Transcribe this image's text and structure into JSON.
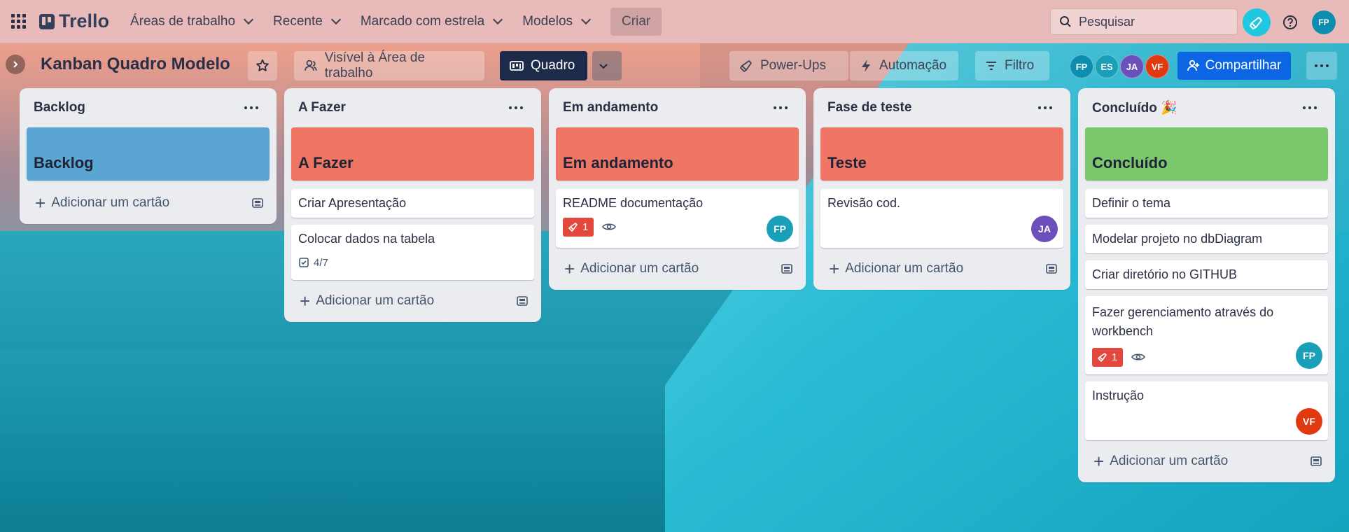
{
  "topbar": {
    "logo": "Trello",
    "nav": [
      {
        "label": "Áreas de trabalho"
      },
      {
        "label": "Recente"
      },
      {
        "label": "Marcado com estrela"
      },
      {
        "label": "Modelos"
      }
    ],
    "create_label": "Criar",
    "search_placeholder": "Pesquisar",
    "user_initials": "FP"
  },
  "board": {
    "title": "Kanban Quadro Modelo",
    "visibility_label": "Visível à Área de trabalho",
    "view_label": "Quadro",
    "powerups_label": "Power-Ups",
    "automation_label": "Automação",
    "filter_label": "Filtro",
    "members": [
      {
        "initials": "FP",
        "color": "#0c8eb0"
      },
      {
        "initials": "ES",
        "color": "#1a9fb8"
      },
      {
        "initials": "JA",
        "color": "#6b4fbb"
      },
      {
        "initials": "VF",
        "color": "#e0380f"
      }
    ],
    "share_label": "Compartilhar"
  },
  "lists": [
    {
      "title": "Backlog",
      "cover": {
        "label": "Backlog",
        "color": "#5aa5d4"
      },
      "cards": [],
      "add_label": "Adicionar um cartão"
    },
    {
      "title": "A Fazer",
      "cover": {
        "label": "A Fazer",
        "color": "#ef7564"
      },
      "cards": [
        {
          "title": "Criar Apresentação"
        },
        {
          "title": "Colocar dados na tabela",
          "checklist": "4/7"
        }
      ],
      "add_label": "Adicionar um cartão"
    },
    {
      "title": "Em andamento",
      "cover": {
        "label": "Em andamento",
        "color": "#ef7564"
      },
      "cards": [
        {
          "title": "README documentação",
          "badge": "1",
          "watch": true,
          "avatar": {
            "initials": "FP",
            "color": "#1a9fb8"
          }
        }
      ],
      "add_label": "Adicionar um cartão"
    },
    {
      "title": "Fase de teste",
      "cover": {
        "label": "Teste",
        "color": "#ef7564"
      },
      "cards": [
        {
          "title": "Revisão cod.",
          "avatar": {
            "initials": "JA",
            "color": "#6b4fbb"
          }
        }
      ],
      "add_label": "Adicionar um cartão"
    },
    {
      "title": "Concluído 🎉",
      "cover": {
        "label": "Concluído",
        "color": "#7bc86c"
      },
      "cards": [
        {
          "title": "Definir o tema"
        },
        {
          "title": "Modelar projeto no dbDiagram"
        },
        {
          "title": "Criar diretório no GITHUB"
        },
        {
          "title": "Fazer gerenciamento através do workbench",
          "badge": "1",
          "watch": true,
          "avatar": {
            "initials": "FP",
            "color": "#1a9fb8"
          }
        },
        {
          "title": "Instrução",
          "avatar": {
            "initials": "VF",
            "color": "#e0380f"
          }
        }
      ],
      "add_label": "Adicionar um cartão"
    }
  ]
}
